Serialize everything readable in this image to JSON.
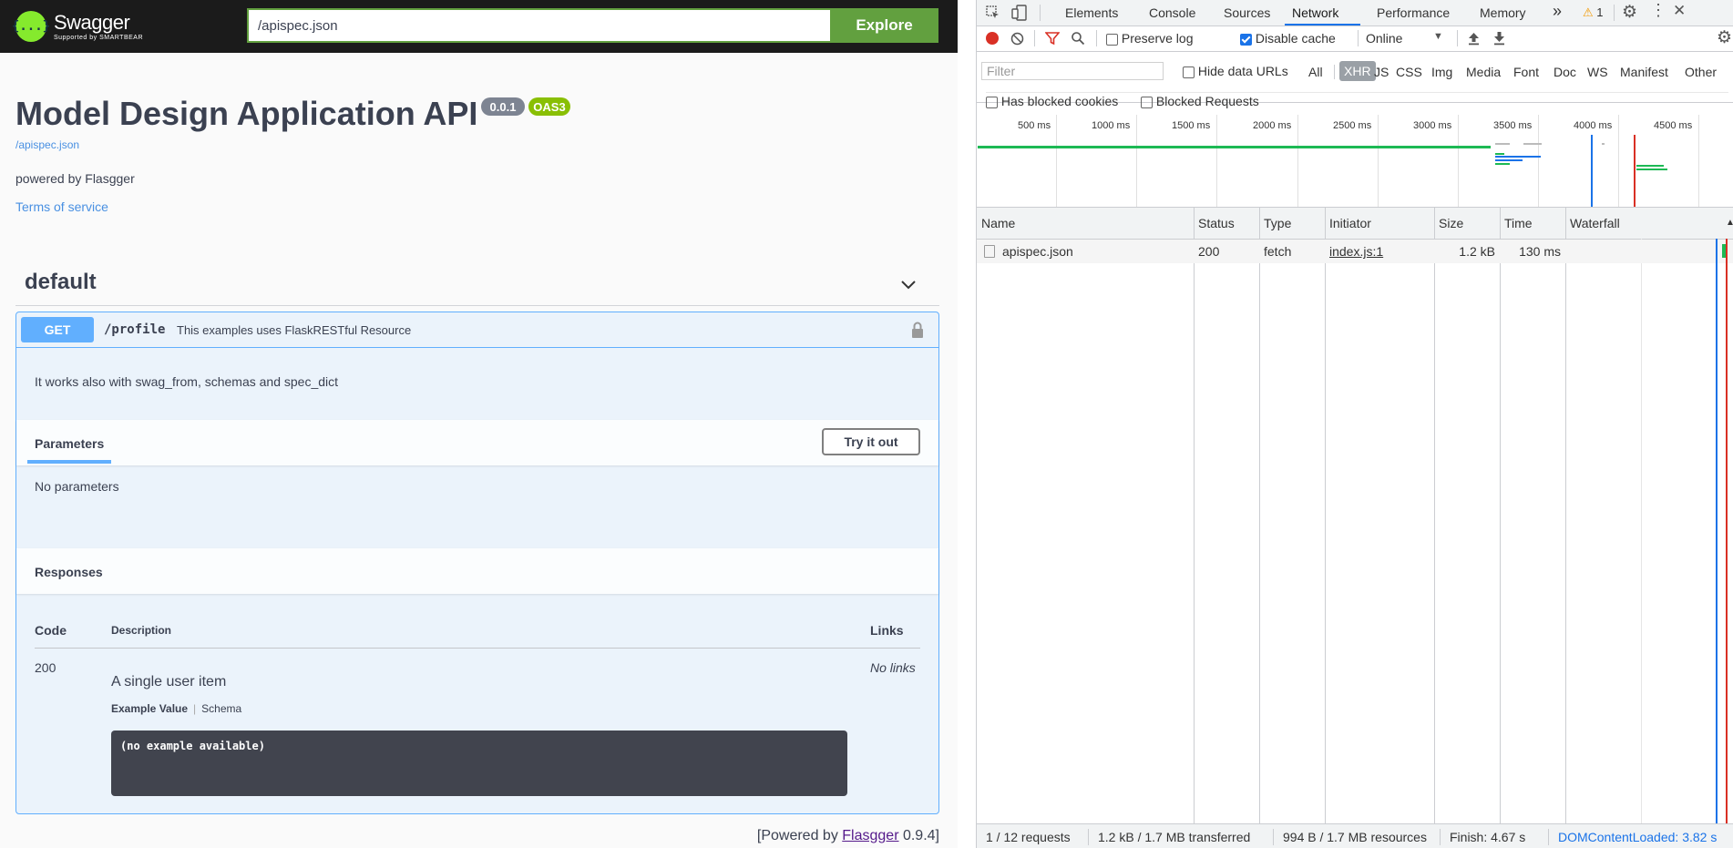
{
  "swagger": {
    "logo": {
      "title": "Swagger",
      "subtitle": "Supported by SMARTBEAR",
      "mark": "{...}"
    },
    "topbar": {
      "url_value": "/apispec.json",
      "explore_label": "Explore"
    },
    "info": {
      "title": "Model Design Application API",
      "version": "0.0.1",
      "oas": "OAS3",
      "spec_link": "/apispec.json",
      "powered": "powered by Flasgger",
      "tos": "Terms of service"
    },
    "tag": {
      "name": "default"
    },
    "operation": {
      "method": "GET",
      "path": "/profile",
      "summary": "This examples uses FlaskRESTful Resource",
      "description": "It works also with swag_from, schemas and spec_dict",
      "params_tab": "Parameters",
      "try_label": "Try it out",
      "no_params": "No parameters",
      "responses_title": "Responses",
      "col_code": "Code",
      "col_desc": "Description",
      "col_links": "Links",
      "response": {
        "code": "200",
        "description": "A single user item",
        "links": "No links",
        "example_tab": "Example Value",
        "schema_tab": "Schema",
        "example": "(no example available)"
      }
    },
    "footer": {
      "prefix": "[Powered by ",
      "link": "Flasgger",
      "suffix": " 0.9.4]"
    }
  },
  "devtools": {
    "tabs": [
      "Elements",
      "Console",
      "Sources",
      "Network",
      "Performance",
      "Memory"
    ],
    "active_tab": "Network",
    "more_tabs": "»",
    "warning_count": "1",
    "toolbar": {
      "preserve_log": "Preserve log",
      "disable_cache": "Disable cache",
      "throttle": "Online"
    },
    "filter": {
      "placeholder": "Filter",
      "hide_data_urls": "Hide data URLs",
      "types": [
        "All",
        "XHR",
        "JS",
        "CSS",
        "Img",
        "Media",
        "Font",
        "Doc",
        "WS",
        "Manifest",
        "Other"
      ],
      "active_type": "XHR",
      "blocked_cookies": "Has blocked cookies",
      "blocked_requests": "Blocked Requests"
    },
    "timeline_labels": [
      "500 ms",
      "1000 ms",
      "1500 ms",
      "2000 ms",
      "2500 ms",
      "3000 ms",
      "3500 ms",
      "4000 ms",
      "4500 ms"
    ],
    "columns": {
      "name": "Name",
      "status": "Status",
      "type": "Type",
      "initiator": "Initiator",
      "size": "Size",
      "time": "Time",
      "waterfall": "Waterfall"
    },
    "requests": [
      {
        "name": "apispec.json",
        "status": "200",
        "type": "fetch",
        "initiator": "index.js:1",
        "size": "1.2 kB",
        "time": "130 ms"
      }
    ],
    "status": {
      "requests": "1 / 12 requests",
      "transferred": "1.2 kB / 1.7 MB transferred",
      "resources": "994 B / 1.7 MB resources",
      "finish": "Finish: 4.67 s",
      "dcl": "DOMContentLoaded: 3.82 s"
    },
    "colors": {
      "accent": "#1a73e8",
      "record": "#d93025",
      "filter": "#d93025",
      "waterfall_green": "#1db954"
    }
  }
}
